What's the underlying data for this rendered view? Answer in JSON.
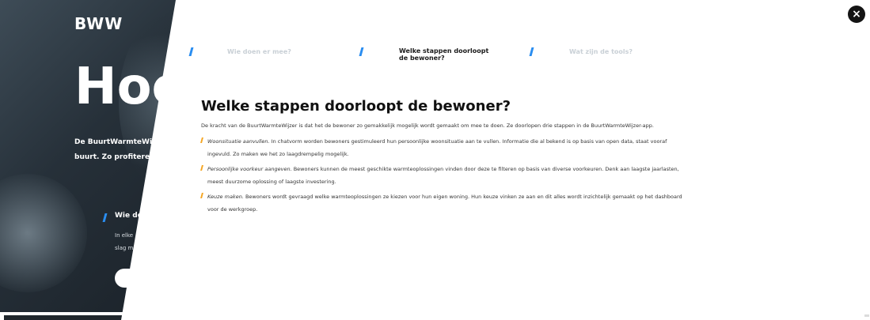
{
  "background": {
    "logo": "BWW",
    "heading": "Hoe",
    "subtext_line1": "De BuurtWarmteWijz",
    "subtext_line2": "buurt. Zo profiteren",
    "sub_heading": "Wie do",
    "sub_body_line1": "In elke",
    "sub_body_line2": "slag m"
  },
  "modal": {
    "close_icon": "×",
    "tabs": [
      {
        "label": "Wie doen er mee?",
        "active": false
      },
      {
        "label": "Welke stappen doorloopt de bewoner?",
        "active": true
      },
      {
        "label": "Wat zijn de tools?",
        "active": false
      }
    ],
    "title": "Welke stappen doorloopt de bewoner?",
    "intro": "De kracht van de BuurtWarmteWijzer is dat het de bewoner zo gemakkelijk mogelijk wordt gemaakt om mee te doen. Ze doorlopen drie stappen in de BuurtWarmteWijzer-app.",
    "steps": [
      {
        "term": "Woonsituatie aanvullen.",
        "text": " In chatvorm worden bewoners gestimuleerd hun persoonlijke woonsituatie aan te vullen. Informatie die al bekend is op basis van open data, staat vooraf ingevuld. Zo maken we het zo laagdrempelig mogelijk."
      },
      {
        "term": "Persoonlijke voorkeur aangeven.",
        "text": " Bewoners kunnen de meest geschikte warmteoplossingen vinden door deze te filteren op basis van diverse voorkeuren. Denk aan laagste jaarlasten, meest duurzome oplossing of laagste investering."
      },
      {
        "term": "Keuze maken.",
        "text": " Bewoners wordt gevraagd welke warmteoplossingen ze kiezen voor hun eigen woning. Hun keuze vinken ze aan en dit alles wordt inzichtelijk gemaakt op het dashboard voor de werkgroep."
      }
    ]
  },
  "colors": {
    "accent_blue": "#2a8df0",
    "accent_orange": "#f5a623",
    "close_bg": "#141414"
  }
}
